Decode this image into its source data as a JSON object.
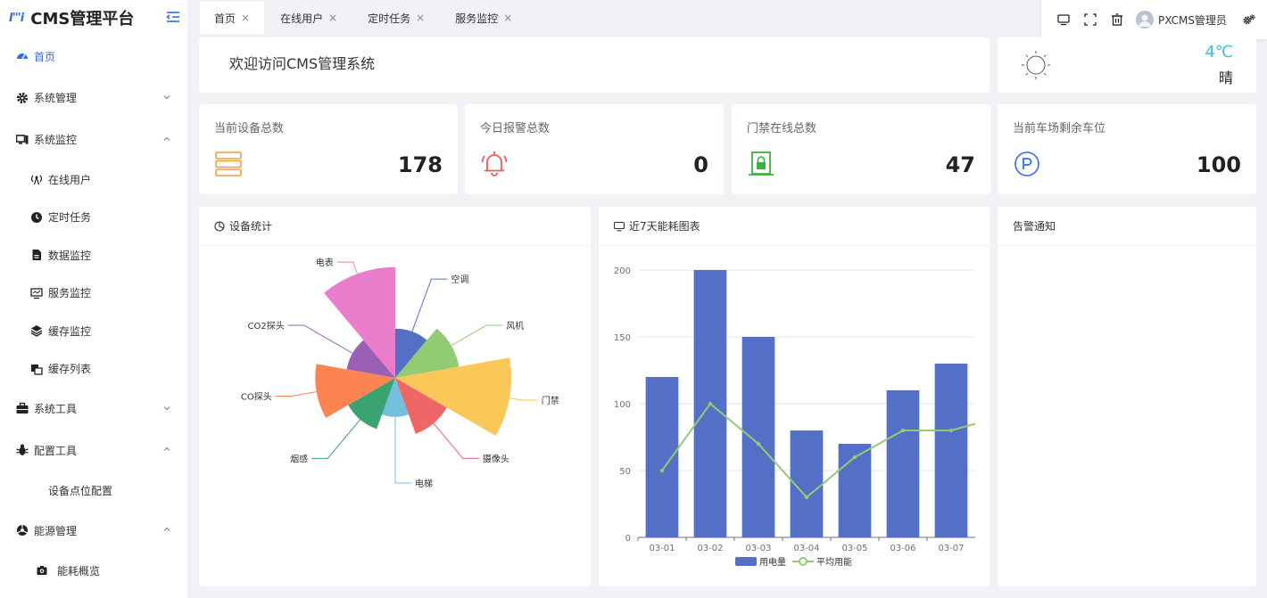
{
  "app": {
    "logo_mark": "I'''i",
    "title": "CMS管理平台"
  },
  "sidebar": {
    "items": [
      {
        "label": "首页",
        "icon": "dashboard-icon",
        "active": true
      },
      {
        "label": "系统管理",
        "icon": "gear-icon",
        "expanded": false
      },
      {
        "label": "系统监控",
        "icon": "monitor-icon",
        "expanded": true,
        "children": [
          {
            "label": "在线用户",
            "icon": "broadcast-icon"
          },
          {
            "label": "定时任务",
            "icon": "clock-icon"
          },
          {
            "label": "数据监控",
            "icon": "document-icon"
          },
          {
            "label": "服务监控",
            "icon": "screen-icon"
          },
          {
            "label": "缓存监控",
            "icon": "layers-icon"
          },
          {
            "label": "缓存列表",
            "icon": "list-icon"
          }
        ]
      },
      {
        "label": "系统工具",
        "icon": "toolbox-icon",
        "expanded": false
      },
      {
        "label": "配置工具",
        "icon": "bug-icon",
        "expanded": true,
        "children": [
          {
            "label": "设备点位配置"
          }
        ]
      },
      {
        "label": "能源管理",
        "icon": "energy-icon",
        "expanded": true,
        "children": [
          {
            "label": "能耗概览",
            "icon": "camera-icon"
          }
        ]
      }
    ]
  },
  "tabs": [
    {
      "label": "首页",
      "active": true
    },
    {
      "label": "在线用户"
    },
    {
      "label": "定时任务"
    },
    {
      "label": "服务监控"
    }
  ],
  "header": {
    "username": "PXCMS管理员"
  },
  "welcome": {
    "text": "欢迎访问CMS管理系统"
  },
  "weather": {
    "temp": "4℃",
    "desc": "晴"
  },
  "stats": [
    {
      "title": "当前设备总数",
      "value": "178",
      "icon": "server-icon",
      "color": "#f39c3a"
    },
    {
      "title": "今日报警总数",
      "value": "0",
      "icon": "alarm-bell-icon",
      "color": "#f05a5a"
    },
    {
      "title": "门禁在线总数",
      "value": "47",
      "icon": "lock-door-icon",
      "color": "#3cb043"
    },
    {
      "title": "当前车场剩余车位",
      "value": "100",
      "icon": "parking-icon",
      "color": "#2f6ee6"
    }
  ],
  "cards": {
    "device_stats": {
      "title": "设备统计"
    },
    "energy": {
      "title": "近7天能耗图表"
    },
    "alerts": {
      "title": "告警通知"
    }
  },
  "chart_data": [
    {
      "type": "pie",
      "subtype": "rose",
      "categories": [
        "空调",
        "风机",
        "门禁",
        "摄像头",
        "电梯",
        "烟感",
        "CO探头",
        "CO2探头",
        "电表"
      ],
      "values": [
        35,
        50,
        100,
        45,
        25,
        40,
        65,
        35,
        95
      ],
      "colors": [
        "#5470c6",
        "#91cc75",
        "#fac858",
        "#ee6666",
        "#73c0de",
        "#3ba272",
        "#fc8452",
        "#9a60b4",
        "#ea7ccc"
      ]
    },
    {
      "type": "bar",
      "categories": [
        "03-01",
        "03-02",
        "03-03",
        "03-04",
        "03-05",
        "03-06",
        "03-07"
      ],
      "series": [
        {
          "name": "用电量",
          "type": "bar",
          "values": [
            120,
            200,
            150,
            80,
            70,
            110,
            130
          ],
          "color": "#5470c6"
        },
        {
          "name": "平均用能",
          "type": "line",
          "values": [
            50,
            100,
            70,
            30,
            60,
            80,
            80
          ],
          "color": "#91cc75"
        }
      ],
      "ylim": [
        0,
        200
      ],
      "yticks": [
        0,
        50,
        100,
        150,
        200
      ],
      "grid": true,
      "legend": "bottom"
    }
  ]
}
